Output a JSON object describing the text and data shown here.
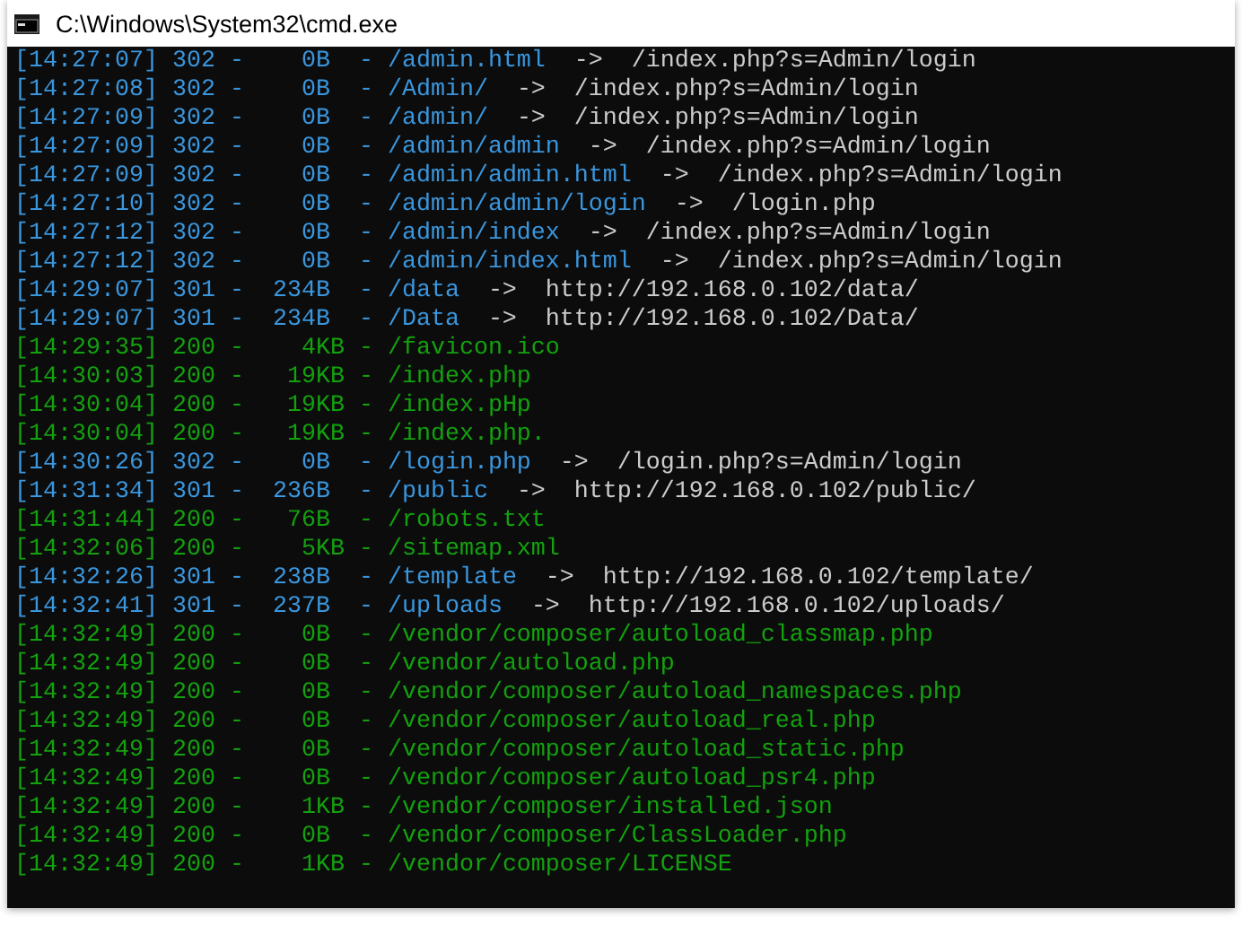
{
  "window": {
    "title": "C:\\Windows\\System32\\cmd.exe"
  },
  "lines": [
    {
      "kind": "redirect",
      "main": "[14:27:07] 302 -    0B  - /admin.html",
      "arrow": "->",
      "target": "/index.php?s=Admin/login"
    },
    {
      "kind": "redirect",
      "main": "[14:27:08] 302 -    0B  - /Admin/",
      "arrow": "->",
      "target": "/index.php?s=Admin/login"
    },
    {
      "kind": "redirect",
      "main": "[14:27:09] 302 -    0B  - /admin/",
      "arrow": "->",
      "target": "/index.php?s=Admin/login"
    },
    {
      "kind": "redirect",
      "main": "[14:27:09] 302 -    0B  - /admin/admin",
      "arrow": "->",
      "target": "/index.php?s=Admin/login"
    },
    {
      "kind": "redirect",
      "main": "[14:27:09] 302 -    0B  - /admin/admin.html",
      "arrow": "->",
      "target": "/index.php?s=Admin/login"
    },
    {
      "kind": "redirect",
      "main": "[14:27:10] 302 -    0B  - /admin/admin/login",
      "arrow": "->",
      "target": "/login.php"
    },
    {
      "kind": "redirect",
      "main": "[14:27:12] 302 -    0B  - /admin/index",
      "arrow": "->",
      "target": "/index.php?s=Admin/login"
    },
    {
      "kind": "redirect",
      "main": "[14:27:12] 302 -    0B  - /admin/index.html",
      "arrow": "->",
      "target": "/index.php?s=Admin/login"
    },
    {
      "kind": "redirect",
      "main": "[14:29:07] 301 -  234B  - /data",
      "arrow": "->",
      "target": "http://192.168.0.102/data/"
    },
    {
      "kind": "redirect",
      "main": "[14:29:07] 301 -  234B  - /Data",
      "arrow": "->",
      "target": "http://192.168.0.102/Data/"
    },
    {
      "kind": "ok",
      "main": "[14:29:35] 200 -    4KB - /favicon.ico"
    },
    {
      "kind": "ok",
      "main": "[14:30:03] 200 -   19KB - /index.php"
    },
    {
      "kind": "ok",
      "main": "[14:30:04] 200 -   19KB - /index.pHp"
    },
    {
      "kind": "ok",
      "main": "[14:30:04] 200 -   19KB - /index.php."
    },
    {
      "kind": "redirect",
      "main": "[14:30:26] 302 -    0B  - /login.php",
      "arrow": "->",
      "target": "/login.php?s=Admin/login"
    },
    {
      "kind": "redirect",
      "main": "[14:31:34] 301 -  236B  - /public",
      "arrow": "->",
      "target": "http://192.168.0.102/public/"
    },
    {
      "kind": "ok",
      "main": "[14:31:44] 200 -   76B  - /robots.txt"
    },
    {
      "kind": "ok",
      "main": "[14:32:06] 200 -    5KB - /sitemap.xml"
    },
    {
      "kind": "redirect",
      "main": "[14:32:26] 301 -  238B  - /template",
      "arrow": "->",
      "target": "http://192.168.0.102/template/"
    },
    {
      "kind": "redirect",
      "main": "[14:32:41] 301 -  237B  - /uploads",
      "arrow": "->",
      "target": "http://192.168.0.102/uploads/"
    },
    {
      "kind": "ok",
      "main": "[14:32:49] 200 -    0B  - /vendor/composer/autoload_classmap.php"
    },
    {
      "kind": "ok",
      "main": "[14:32:49] 200 -    0B  - /vendor/autoload.php"
    },
    {
      "kind": "ok",
      "main": "[14:32:49] 200 -    0B  - /vendor/composer/autoload_namespaces.php"
    },
    {
      "kind": "ok",
      "main": "[14:32:49] 200 -    0B  - /vendor/composer/autoload_real.php"
    },
    {
      "kind": "ok",
      "main": "[14:32:49] 200 -    0B  - /vendor/composer/autoload_static.php"
    },
    {
      "kind": "ok",
      "main": "[14:32:49] 200 -    0B  - /vendor/composer/autoload_psr4.php"
    },
    {
      "kind": "ok",
      "main": "[14:32:49] 200 -    1KB - /vendor/composer/installed.json"
    },
    {
      "kind": "ok",
      "main": "[14:32:49] 200 -    0B  - /vendor/composer/ClassLoader.php"
    },
    {
      "kind": "ok",
      "main": "[14:32:49] 200 -    1KB - /vendor/composer/LICENSE"
    }
  ]
}
